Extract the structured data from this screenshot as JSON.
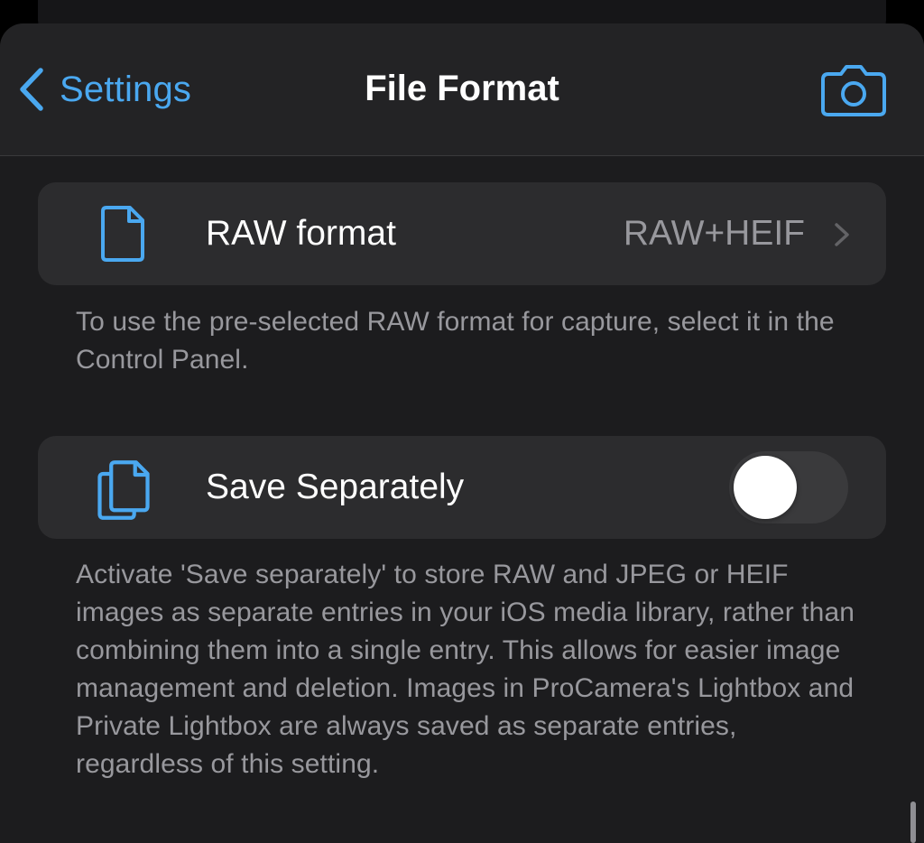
{
  "nav": {
    "back_label": "Settings",
    "title": "File Format",
    "back_icon": "chevron-left-icon",
    "camera_icon": "camera-icon"
  },
  "raw_format": {
    "label": "RAW format",
    "value": "RAW+HEIF",
    "icon": "document-icon",
    "footnote": "To use the pre-selected RAW format for capture, select it in the Control Panel."
  },
  "save_separately": {
    "label": "Save Separately",
    "enabled": false,
    "icon": "documents-icon",
    "footnote": "Activate 'Save separately' to store RAW and JPEG or HEIF images as separate entries in your iOS media library, rather than combining them into a single entry. This allows for easier image management and deletion. Images in ProCamera's Lightbox and Private Lightbox are always saved as separate entries, regardless of this setting."
  },
  "colors": {
    "accent": "#4aa8f0",
    "background": "#1c1c1e",
    "card": "#2c2c2e",
    "secondary_text": "#98989d"
  }
}
